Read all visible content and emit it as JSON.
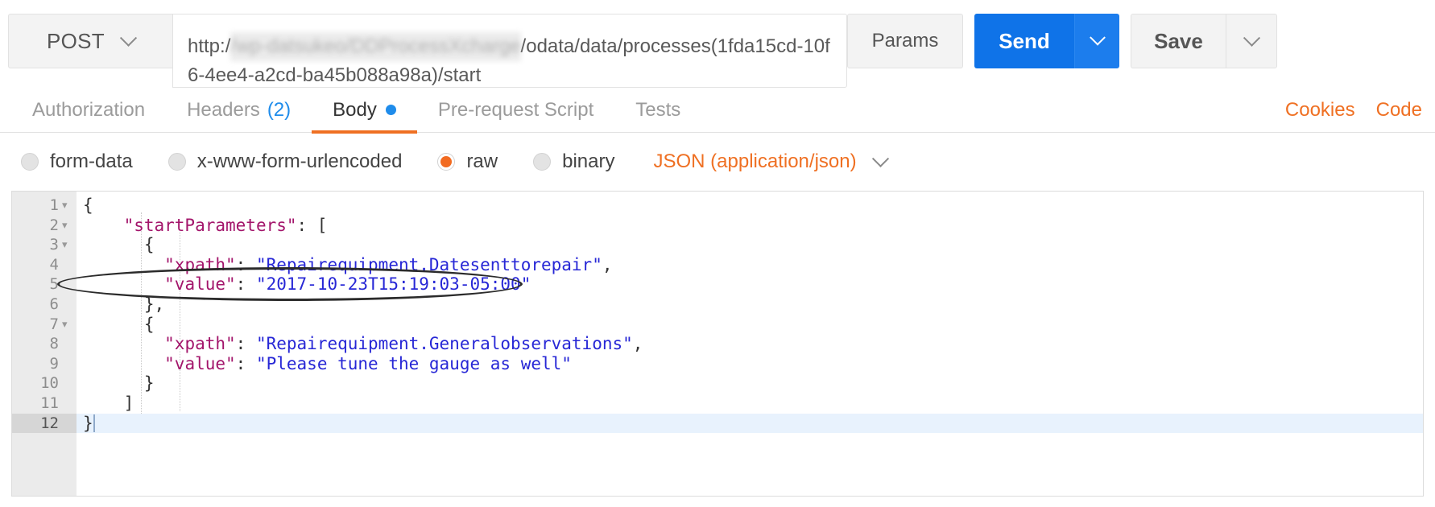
{
  "request_bar": {
    "method": "POST",
    "method_caret_icon": "chevron-down-icon",
    "url_prefix": "http:/",
    "url_redacted": "/wp-datsukeo/DDProcessXcharge",
    "url_suffix": "/odata/data/processes(1fda15cd-10f6-4ee4-a2cd-ba45b088a98a)/start",
    "params_label": "Params",
    "send_label": "Send",
    "send_caret_icon": "chevron-down-icon",
    "save_label": "Save",
    "save_caret_icon": "chevron-down-icon"
  },
  "tabs": [
    {
      "label": "Authorization",
      "count": "",
      "dot": false,
      "active": false
    },
    {
      "label": "Headers",
      "count": "(2)",
      "dot": false,
      "active": false
    },
    {
      "label": "Body",
      "count": "",
      "dot": true,
      "active": true
    },
    {
      "label": "Pre-request Script",
      "count": "",
      "dot": false,
      "active": false
    },
    {
      "label": "Tests",
      "count": "",
      "dot": false,
      "active": false
    }
  ],
  "right_links": [
    {
      "label": "Cookies"
    },
    {
      "label": "Code"
    }
  ],
  "body_types": [
    {
      "label": "form-data",
      "checked": false
    },
    {
      "label": "x-www-form-urlencoded",
      "checked": false
    },
    {
      "label": "raw",
      "checked": true
    },
    {
      "label": "binary",
      "checked": false
    }
  ],
  "content_type_select": {
    "label": "JSON (application/json)",
    "caret_icon": "chevron-down-icon"
  },
  "editor": {
    "lines": [
      {
        "num": "1",
        "foldable": true,
        "active": false,
        "tokens": [
          {
            "t": "p",
            "v": "{"
          }
        ]
      },
      {
        "num": "2",
        "foldable": true,
        "active": false,
        "tokens": [
          {
            "t": "p",
            "v": "    "
          },
          {
            "t": "k",
            "v": "\"startParameters\""
          },
          {
            "t": "p",
            "v": ": ["
          }
        ]
      },
      {
        "num": "3",
        "foldable": true,
        "active": false,
        "tokens": [
          {
            "t": "p",
            "v": "      {"
          }
        ]
      },
      {
        "num": "4",
        "foldable": false,
        "active": false,
        "tokens": [
          {
            "t": "p",
            "v": "        "
          },
          {
            "t": "k",
            "v": "\"xpath\""
          },
          {
            "t": "p",
            "v": ": "
          },
          {
            "t": "s",
            "v": "\"Repairequipment.Datesenttorepair\""
          },
          {
            "t": "p",
            "v": ","
          }
        ]
      },
      {
        "num": "5",
        "foldable": false,
        "active": false,
        "tokens": [
          {
            "t": "p",
            "v": "        "
          },
          {
            "t": "k",
            "v": "\"value\""
          },
          {
            "t": "p",
            "v": ": "
          },
          {
            "t": "s",
            "v": "\"2017-10-23T15:19:03-05:00\""
          }
        ]
      },
      {
        "num": "6",
        "foldable": false,
        "active": false,
        "tokens": [
          {
            "t": "p",
            "v": "      },"
          }
        ]
      },
      {
        "num": "7",
        "foldable": true,
        "active": false,
        "tokens": [
          {
            "t": "p",
            "v": "      {"
          }
        ]
      },
      {
        "num": "8",
        "foldable": false,
        "active": false,
        "tokens": [
          {
            "t": "p",
            "v": "        "
          },
          {
            "t": "k",
            "v": "\"xpath\""
          },
          {
            "t": "p",
            "v": ": "
          },
          {
            "t": "s",
            "v": "\"Repairequipment.Generalobservations\""
          },
          {
            "t": "p",
            "v": ","
          }
        ]
      },
      {
        "num": "9",
        "foldable": false,
        "active": false,
        "tokens": [
          {
            "t": "p",
            "v": "        "
          },
          {
            "t": "k",
            "v": "\"value\""
          },
          {
            "t": "p",
            "v": ": "
          },
          {
            "t": "s",
            "v": "\"Please tune the gauge as well\""
          }
        ]
      },
      {
        "num": "10",
        "foldable": false,
        "active": false,
        "tokens": [
          {
            "t": "p",
            "v": "      }"
          }
        ]
      },
      {
        "num": "11",
        "foldable": false,
        "active": false,
        "tokens": [
          {
            "t": "p",
            "v": "    ]"
          }
        ]
      },
      {
        "num": "12",
        "foldable": false,
        "active": true,
        "tokens": [
          {
            "t": "p",
            "v": "}"
          }
        ]
      }
    ],
    "fold_icon": "triangle-down-icon"
  },
  "annotation": {
    "shape": "ellipse",
    "target_line": "5",
    "color": "#2b2b2b"
  },
  "colors": {
    "accent_orange": "#ef7023",
    "send_blue": "#0f73e8",
    "tab_blue": "#1f8ceb",
    "json_key": "#a3156b",
    "json_string": "#2727d6"
  }
}
